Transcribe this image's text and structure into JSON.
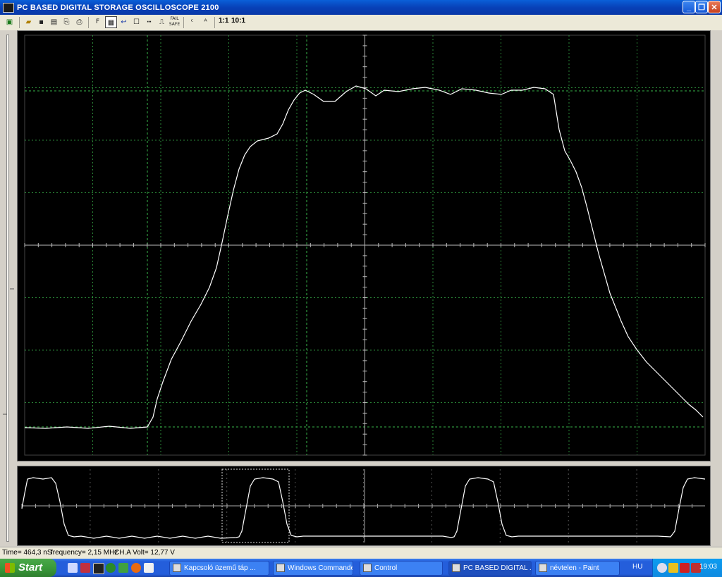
{
  "window": {
    "title": "PC BASED DIGITAL STORAGE OSCILLOSCOPE 2100",
    "minimize_icon": "minimize-icon",
    "maximize_icon": "restore-icon",
    "close_icon": "close-icon"
  },
  "toolbar": {
    "fft_label": "F",
    "ratio_1_label": "1:1",
    "ratio_10_label": "10:1",
    "fail_safe_label": "FAIL SAFE"
  },
  "status": {
    "time": "Time= 464,3 nS",
    "frequency": "frequency= 2,15 MHz",
    "volt": "CH.A Volt= 12,77 V"
  },
  "taskbar": {
    "start_label": "Start",
    "tasks": [
      {
        "label": "Kapcsoló üzemű táp ..."
      },
      {
        "label": "Windows Commande..."
      },
      {
        "label": "Control"
      },
      {
        "label": "PC BASED DIGITAL ..."
      },
      {
        "label": "névtelen - Paint"
      }
    ],
    "language": "HU",
    "clock": "19:03"
  },
  "colors": {
    "trace": "#ffffff",
    "grid": "#39b34a",
    "screen_bg": "#000000"
  }
}
